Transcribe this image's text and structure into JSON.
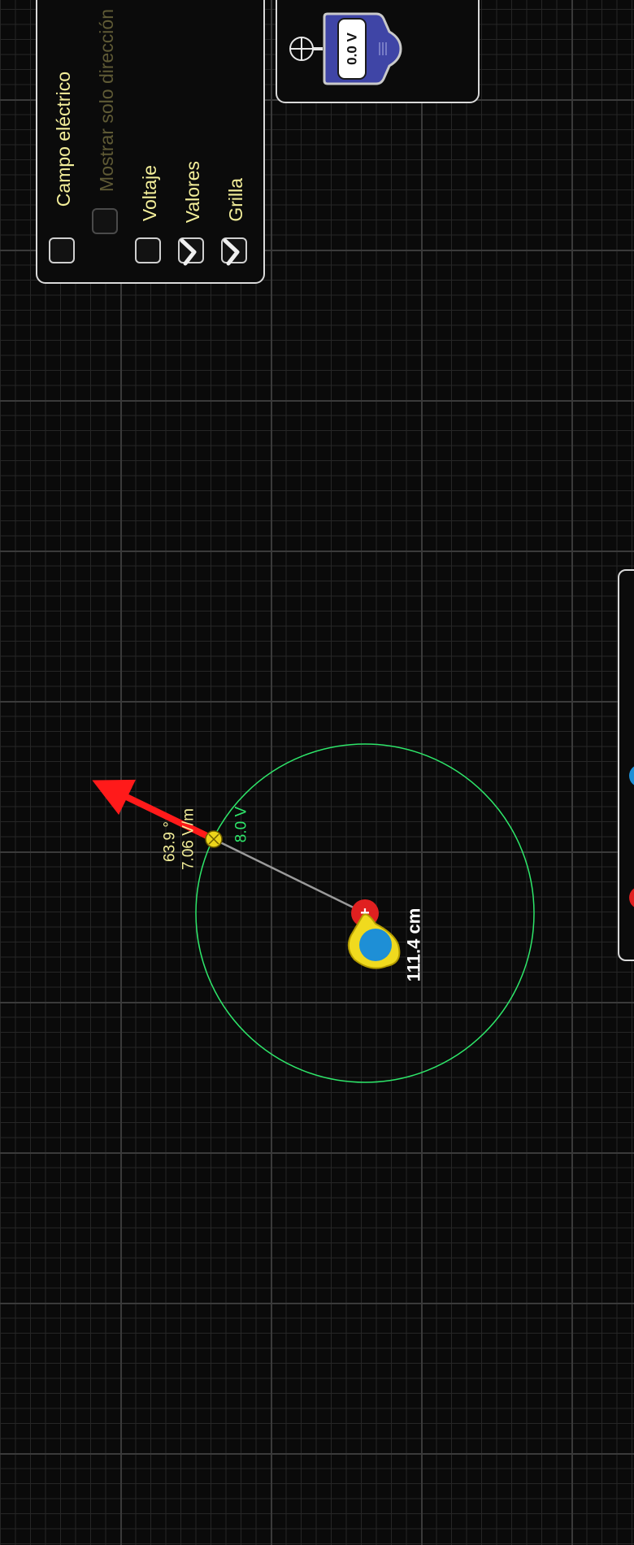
{
  "controls": {
    "electric_field": {
      "label": "Campo eléctrico",
      "checked": false
    },
    "direction_only": {
      "label": "Mostrar solo dirección",
      "checked": false,
      "enabled": false
    },
    "voltage": {
      "label": "Voltaje",
      "checked": false
    },
    "values": {
      "label": "Valores",
      "checked": true
    },
    "grid": {
      "label": "Grilla",
      "checked": true
    }
  },
  "voltmeter": {
    "reading": "0.0 V"
  },
  "field_sensor": {
    "angle": "63.9 °",
    "magnitude": "7.06 V/m"
  },
  "equipotential": {
    "label": "8.0 V",
    "color": "#2ee66a"
  },
  "tape_measure": {
    "reading": "111.4 cm"
  },
  "charge": {
    "symbol": "+",
    "color": "#e02020"
  },
  "colors": {
    "label_text": "#f4ef9a",
    "field_arrow": "#ff1a1a",
    "sensor": "#ecd51a",
    "tape_body": "#f0da1e",
    "tape_center": "#1e8fd6",
    "toolbox_blue": "#3f45a6"
  }
}
